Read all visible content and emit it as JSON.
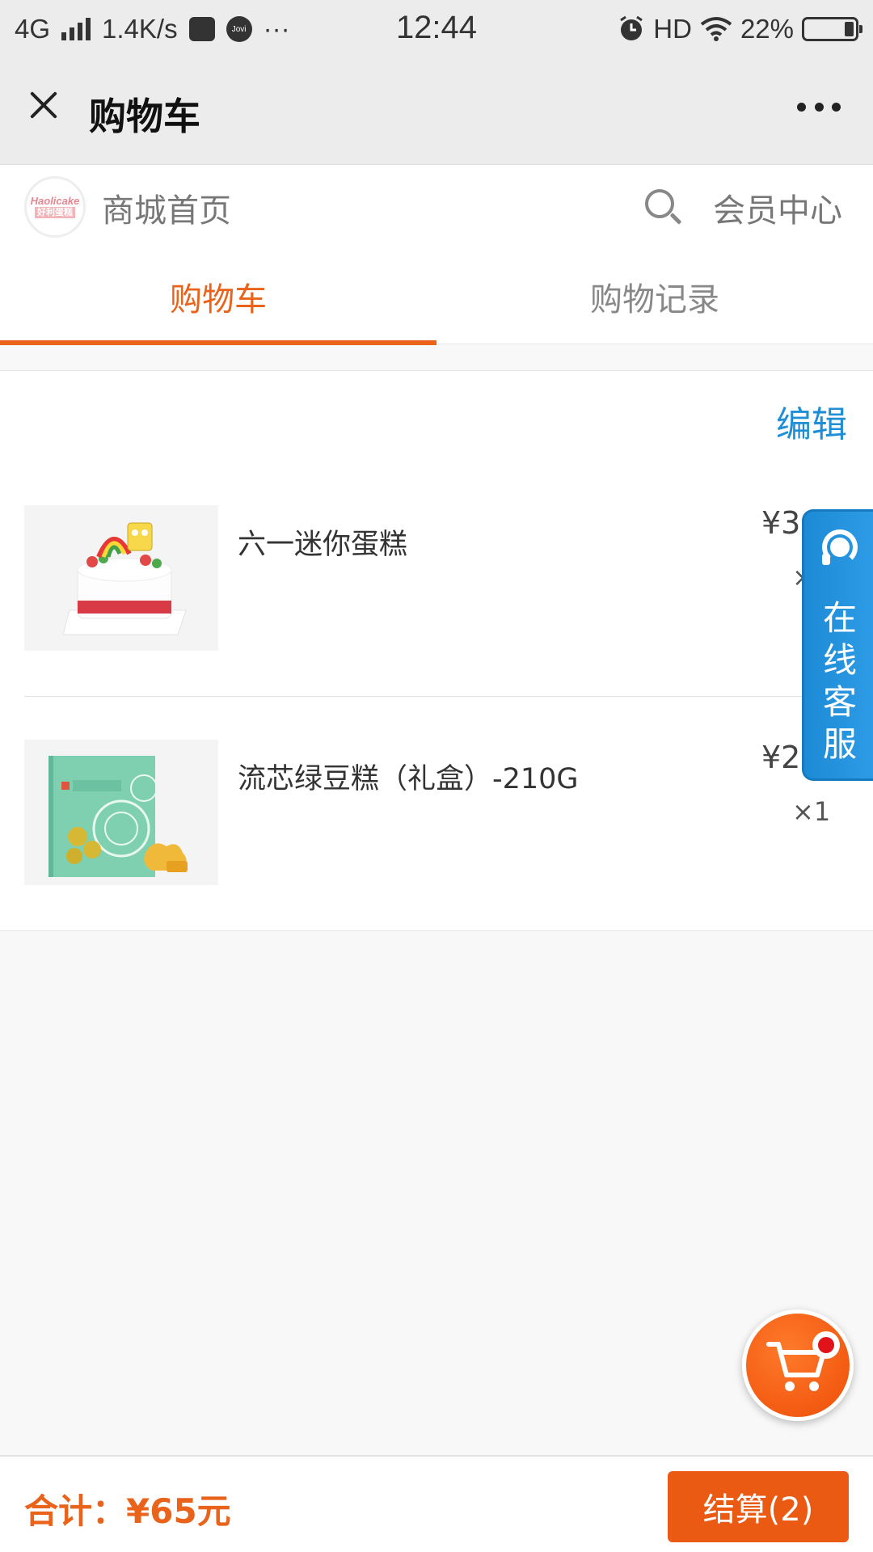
{
  "status_bar": {
    "network": "4G",
    "speed": "1.4K/s",
    "jovi_label": "Jovi",
    "more": "···",
    "time": "12:44",
    "hd": "HD",
    "battery": "22%"
  },
  "title_bar": {
    "title": "购物车"
  },
  "store_header": {
    "logo_text": "Haolicake",
    "logo_sub": "好利蛋糕",
    "home_label": "商城首页",
    "member_label": "会员中心"
  },
  "tabs": [
    {
      "label": "购物车",
      "active": true
    },
    {
      "label": "购物记录",
      "active": false
    }
  ],
  "cart": {
    "edit_label": "编辑",
    "items": [
      {
        "name": "六一迷你蛋糕",
        "price": "¥3",
        "quantity": "×"
      },
      {
        "name": "流芯绿豆糕（礼盒）-210G",
        "price": "¥2",
        "quantity": "×1"
      }
    ]
  },
  "service_float": {
    "label": "在线客服",
    "chars": [
      "在",
      "线",
      "客",
      "服"
    ]
  },
  "bottom_bar": {
    "total": "合计：¥65元",
    "checkout": "结算(2)"
  },
  "colors": {
    "accent": "#e9631a",
    "edit": "#1e8fd6",
    "service": "#1d8ad6",
    "badge": "#e0121a"
  }
}
